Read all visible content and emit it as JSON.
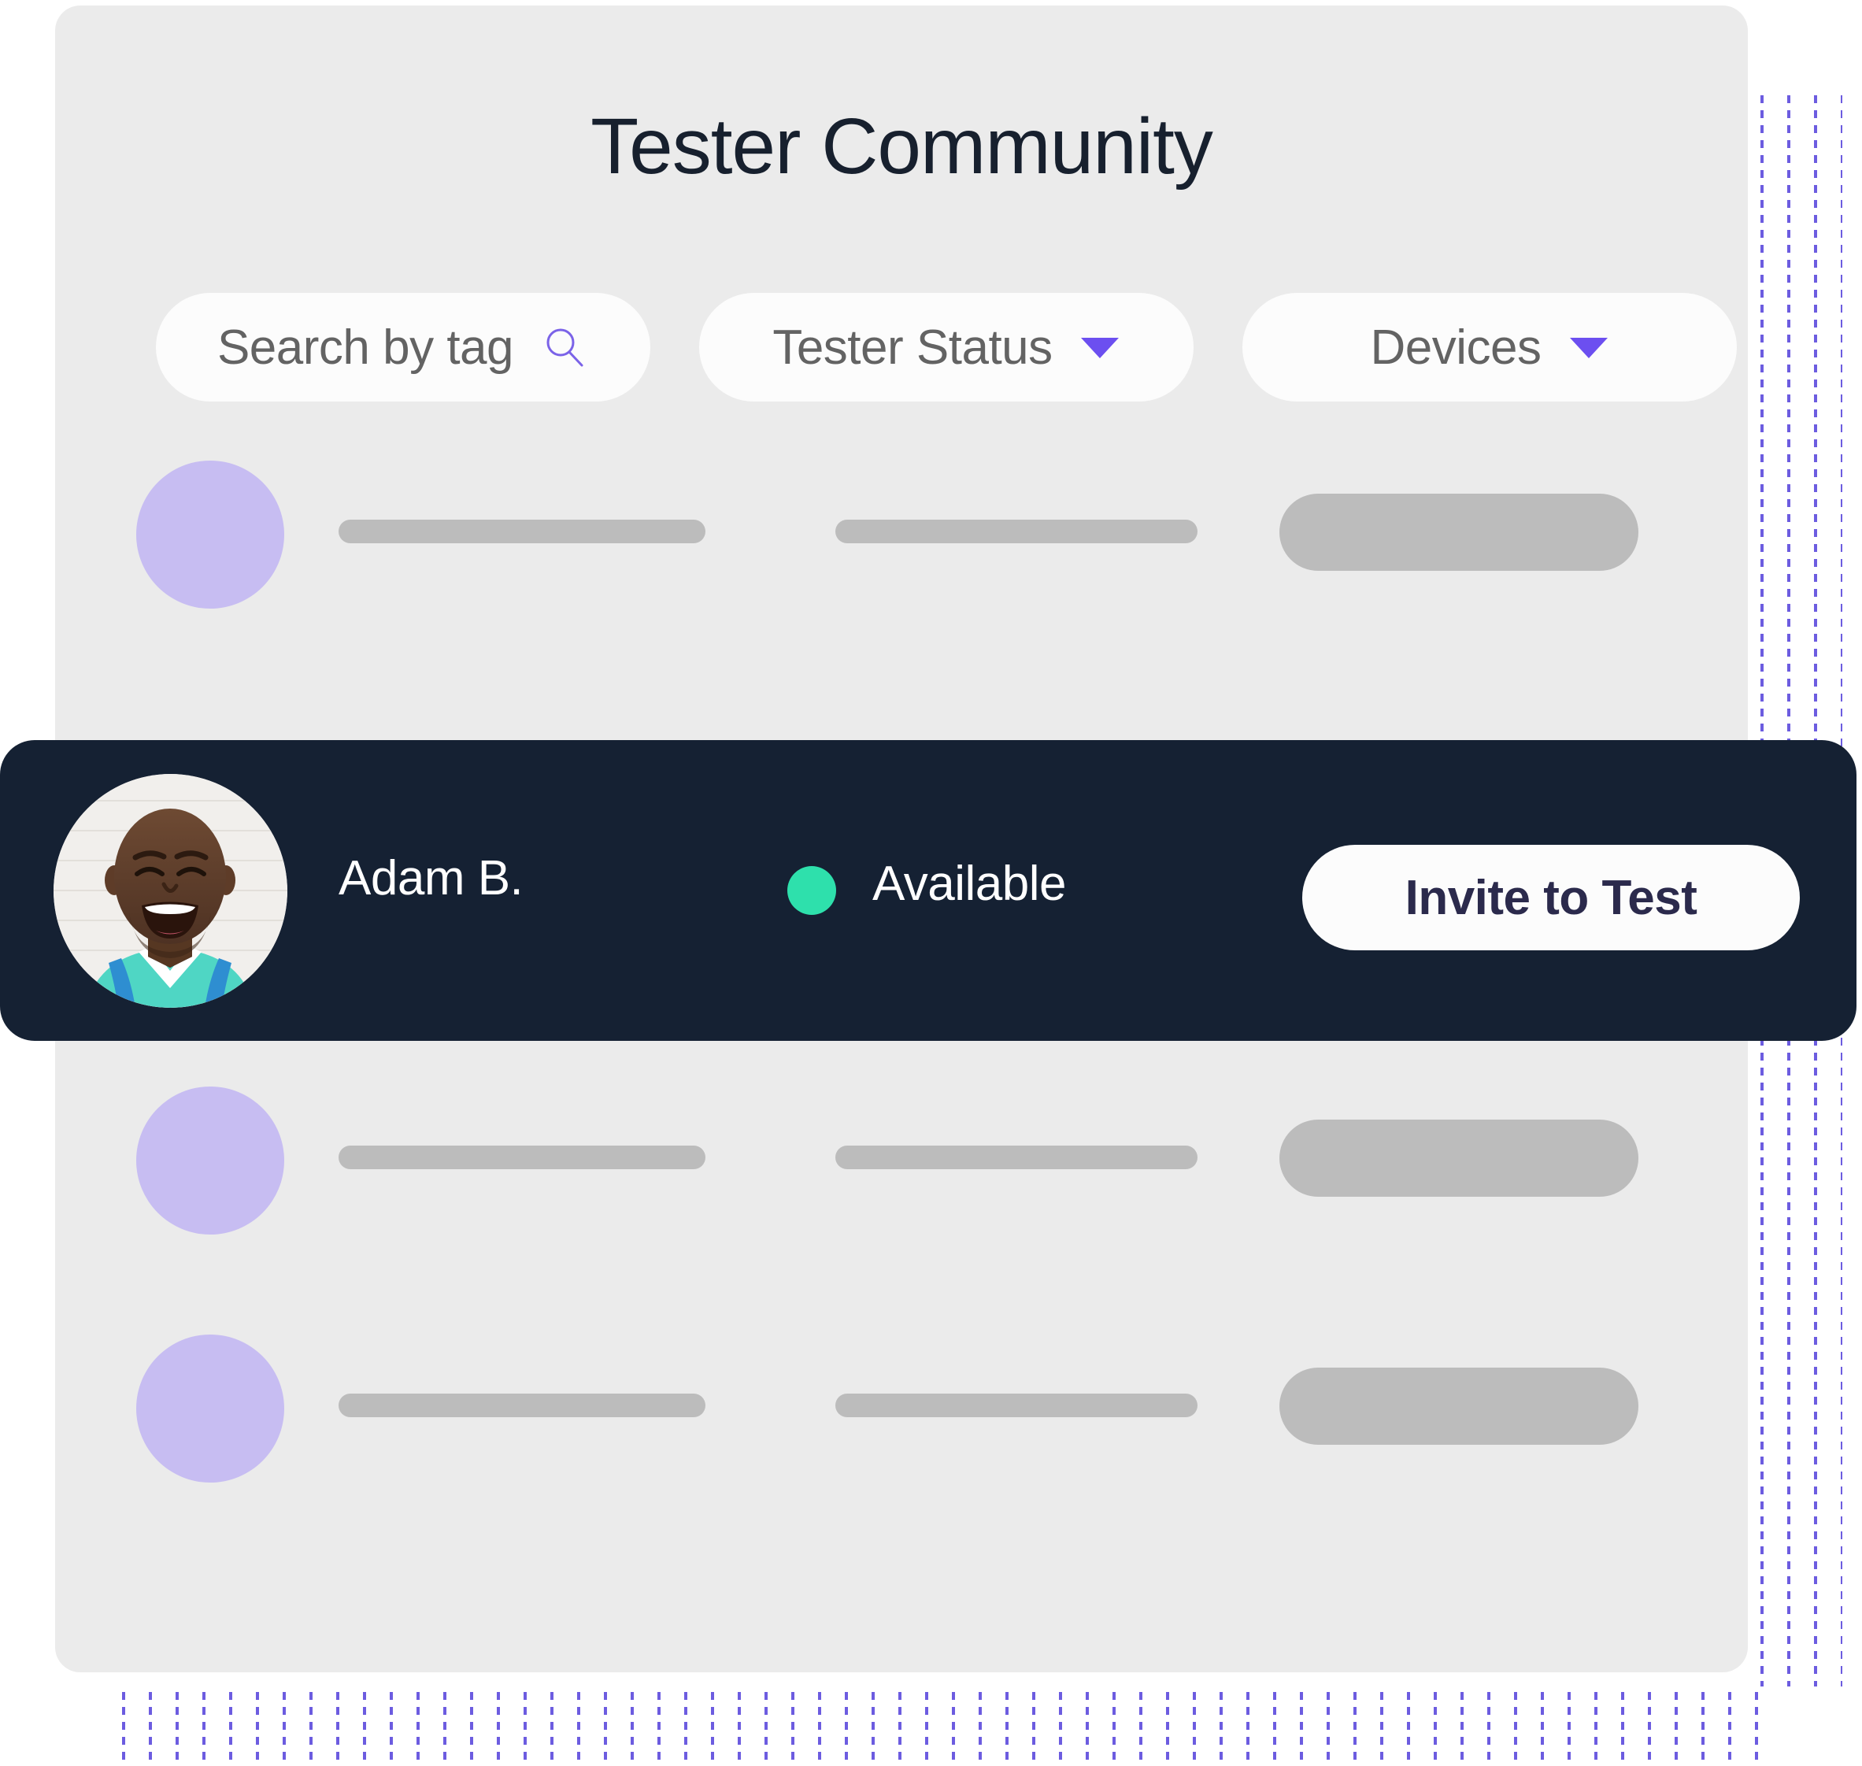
{
  "page": {
    "title": "Tester Community",
    "background": "#FFFFFF",
    "card_bg": "#EBEBEB",
    "accent_purple": "#6C5CE0",
    "dark_navy": "#152133",
    "available_green": "#2EE0AC",
    "button_text_color": "#2B2A4C",
    "skeleton_avatar_color": "#C7BDF2",
    "skeleton_bar_color": "#BCBCBC"
  },
  "filters": {
    "search": {
      "placeholder": "Search by tag",
      "icon": "search-icon"
    },
    "tester_status": {
      "label": "Tester Status",
      "icon": "chevron-down-icon"
    },
    "devices": {
      "label": "Devices",
      "icon": "chevron-down-icon"
    }
  },
  "active_tester": {
    "name": "Adam B.",
    "status": "Available",
    "status_color": "#2EE0AC",
    "action_label": "Invite to Test",
    "avatar": "photo-smiling-man-teal-jersey"
  },
  "skeleton_rows": [
    {
      "id": "row-1"
    },
    {
      "id": "row-2"
    },
    {
      "id": "row-3"
    }
  ],
  "decoration": {
    "right_dot_grid": "purple-dash-grid",
    "bottom_dot_grid": "purple-dash-grid"
  }
}
